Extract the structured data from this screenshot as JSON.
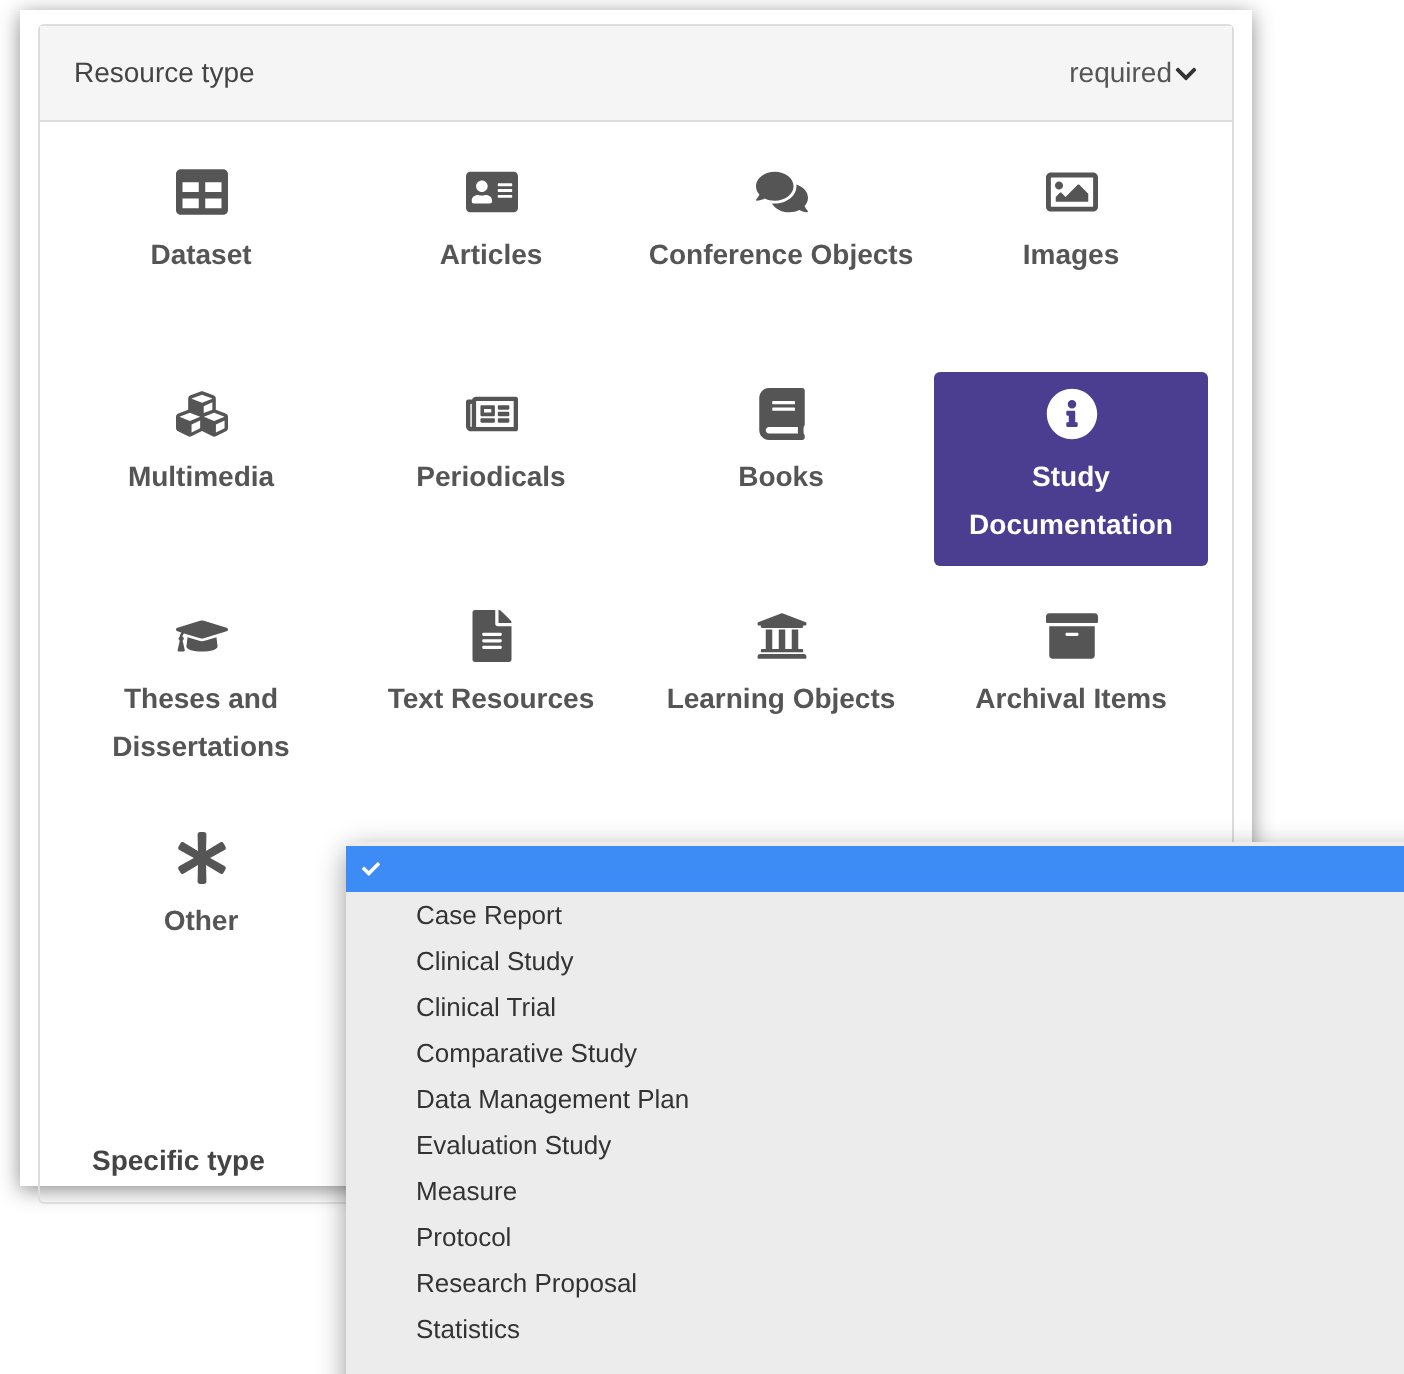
{
  "panel": {
    "title": "Resource type",
    "required_label": "required"
  },
  "resource_types": [
    {
      "label": "Dataset",
      "selected": false
    },
    {
      "label": "Articles",
      "selected": false
    },
    {
      "label": "Conference Objects",
      "selected": false
    },
    {
      "label": "Images",
      "selected": false
    },
    {
      "label": "Multimedia",
      "selected": false
    },
    {
      "label": "Periodicals",
      "selected": false
    },
    {
      "label": "Books",
      "selected": false
    },
    {
      "label": "Study Documentation",
      "selected": true
    },
    {
      "label": "Theses and Dissertations",
      "selected": false
    },
    {
      "label": "Text Resources",
      "selected": false
    },
    {
      "label": "Learning Objects",
      "selected": false
    },
    {
      "label": "Archival Items",
      "selected": false
    },
    {
      "label": "Other",
      "selected": false
    }
  ],
  "specific_type": {
    "label": "Specific type"
  },
  "dropdown_options": [
    {
      "selected": true
    },
    {
      "label": "Case Report",
      "selected": false
    },
    {
      "label": "Clinical Study",
      "selected": false
    },
    {
      "label": "Clinical Trial",
      "selected": false
    },
    {
      "label": "Comparative Study",
      "selected": false
    },
    {
      "label": "Data Management Plan",
      "selected": false
    },
    {
      "label": "Evaluation Study",
      "selected": false
    },
    {
      "label": "Measure",
      "selected": false
    },
    {
      "label": "Protocol",
      "selected": false
    },
    {
      "label": "Research Proposal",
      "selected": false
    },
    {
      "label": "Statistics",
      "selected": false
    }
  ]
}
